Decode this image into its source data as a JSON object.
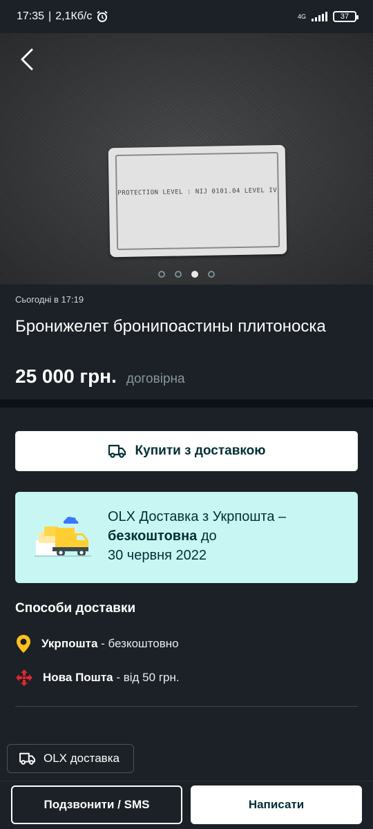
{
  "status_bar": {
    "time": "17:35",
    "speed": "2,1Кб/с",
    "network": "4G",
    "battery": "37"
  },
  "gallery": {
    "label_text": "PROTECTION LEVEL : NIJ 0101.04 LEVEL IV",
    "pages_total": 4,
    "current_page": 3
  },
  "listing": {
    "posted": "Сьогодні в 17:19",
    "title": "Бронижелет бронипоастины плитоноска",
    "price": "25 000 грн.",
    "negotiable": "договірна"
  },
  "buy": {
    "label": "Купити з доставкою"
  },
  "promo": {
    "line1": "OLX Доставка з Укрпошта –",
    "bold": "безкоштовна",
    "after_bold": " до",
    "line3": "30 червня 2022"
  },
  "delivery": {
    "title": "Способи доставки",
    "methods": [
      {
        "name": "Укрпошта",
        "detail": " - безкоштовно",
        "icon": "ukrposhta-pin-icon",
        "color": "#ffc01d"
      },
      {
        "name": "Нова Пошта",
        "detail": " - від 50 грн.",
        "icon": "nova-poshta-icon",
        "color": "#e3262d"
      }
    ]
  },
  "olx_chip": {
    "label": "OLX доставка"
  },
  "actions": {
    "call": "Подзвонити / SMS",
    "write": "Написати"
  }
}
